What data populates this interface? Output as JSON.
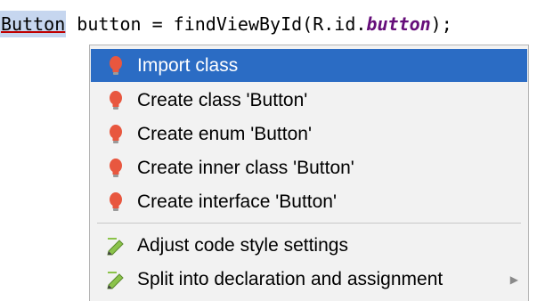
{
  "code": {
    "type_token": "Button",
    "rest_before": " button = findViewById(R.id.",
    "field_token": "button",
    "rest_after": ");"
  },
  "popup": {
    "items": [
      {
        "label": "Import class",
        "icon": "bulb-icon",
        "selected": true
      },
      {
        "label": "Create class 'Button'",
        "icon": "bulb-icon"
      },
      {
        "label": "Create enum 'Button'",
        "icon": "bulb-icon"
      },
      {
        "label": "Create inner class 'Button'",
        "icon": "bulb-icon"
      },
      {
        "label": "Create interface 'Button'",
        "icon": "bulb-icon"
      },
      {
        "label": "Adjust code style settings",
        "icon": "pencil-icon"
      },
      {
        "label": "Split into declaration and assignment",
        "icon": "pencil-icon",
        "submenu": true
      }
    ]
  },
  "colors": {
    "selection": "#2b6cc4",
    "bulb": "#e8573f",
    "field": "#660e7a"
  }
}
